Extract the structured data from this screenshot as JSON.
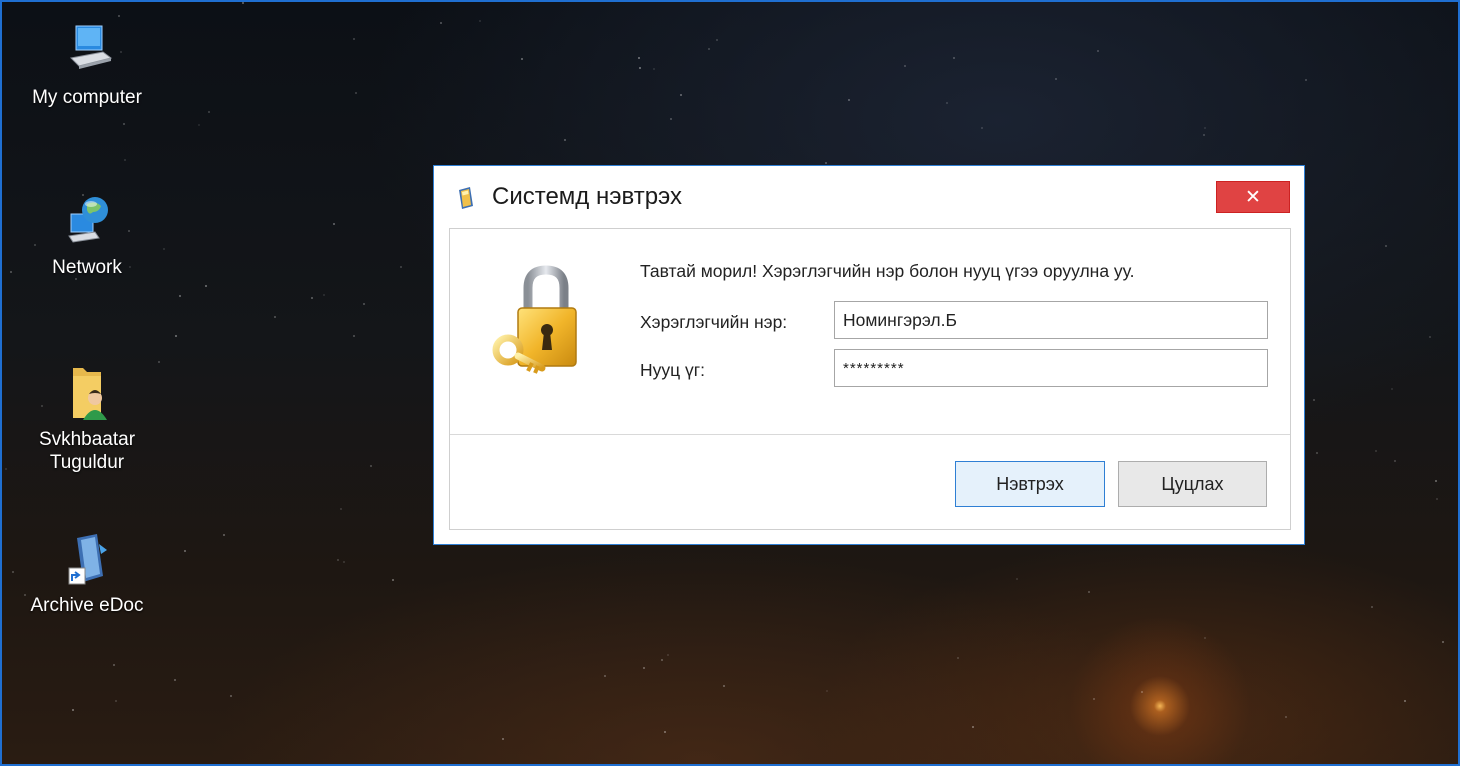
{
  "desktop": {
    "icons": [
      {
        "label": "My computer",
        "icon": "computer-icon"
      },
      {
        "label": "Network",
        "icon": "network-globe-icon"
      },
      {
        "label_line1": "Svkhbaatar",
        "label_line2": "Tuguldur",
        "icon": "user-folder-icon"
      },
      {
        "label": "Archive eDoc",
        "icon": "archive-shortcut-icon"
      }
    ]
  },
  "dialog": {
    "title": "Системд нэвтрэх",
    "close_label": "✕",
    "welcome": "Тавтай морил! Хэрэглэгчийн нэр болон нууц үгээ оруулна уу.",
    "username_label": "Хэрэглэгчийн нэр:",
    "username_value": "Номингэрэл.Б",
    "password_label": "Нууц үг:",
    "password_value": "*********",
    "login_button": "Нэвтрэх",
    "cancel_button": "Цуцлах"
  },
  "colors": {
    "accent": "#2f7fd4",
    "close": "#e04343"
  }
}
